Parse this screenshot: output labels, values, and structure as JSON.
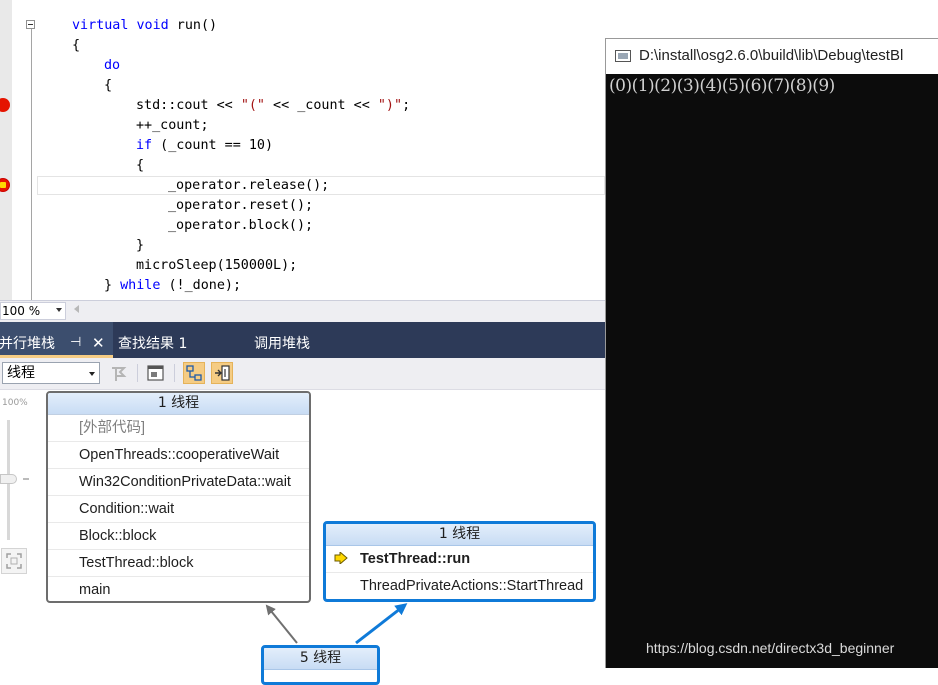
{
  "editor": {
    "lines": [
      {
        "indent": 0,
        "tokens": [
          {
            "t": "virtual void",
            "k": "kw"
          },
          {
            "t": " run()"
          }
        ]
      },
      {
        "indent": 0,
        "tokens": [
          {
            "t": "{"
          }
        ]
      },
      {
        "indent": 1,
        "tokens": [
          {
            "t": "do",
            "k": "kw"
          }
        ]
      },
      {
        "indent": 1,
        "tokens": [
          {
            "t": "{"
          }
        ]
      },
      {
        "indent": 2,
        "tokens": [
          {
            "t": "std::cout << "
          },
          {
            "t": "\"(\"",
            "k": "str"
          },
          {
            "t": " << _count << "
          },
          {
            "t": "\")\"",
            "k": "str"
          },
          {
            "t": ";"
          }
        ]
      },
      {
        "indent": 2,
        "tokens": [
          {
            "t": "++_count;"
          }
        ]
      },
      {
        "indent": 2,
        "tokens": [
          {
            "t": "if",
            "k": "kw"
          },
          {
            "t": " (_count == 10)"
          }
        ]
      },
      {
        "indent": 2,
        "tokens": [
          {
            "t": "{"
          }
        ]
      },
      {
        "indent": 3,
        "tokens": [
          {
            "t": "_operator.release();"
          }
        ]
      },
      {
        "indent": 3,
        "tokens": [
          {
            "t": "_operator.reset();"
          }
        ]
      },
      {
        "indent": 3,
        "tokens": [
          {
            "t": "_operator.block();"
          }
        ]
      },
      {
        "indent": 2,
        "tokens": [
          {
            "t": "}"
          }
        ]
      },
      {
        "indent": 2,
        "tokens": [
          {
            "t": "microSleep(150000L);"
          }
        ]
      },
      {
        "indent": 1,
        "tokens": [
          {
            "t": "} "
          },
          {
            "t": "while",
            "k": "kw"
          },
          {
            "t": " (!_done);"
          }
        ]
      }
    ],
    "zoom": "100 %"
  },
  "console": {
    "title": "D:\\install\\osg2.6.0\\build\\lib\\Debug\\testBl",
    "output": "(0)(1)(2)(3)(4)(5)(6)(7)(8)(9)"
  },
  "tabs": {
    "active": "并行堆栈",
    "pin": "⊣",
    "close": "✕",
    "find": "查找结果 1",
    "callstack": "调用堆栈"
  },
  "toolbar": {
    "view_combo": "线程"
  },
  "canvas": {
    "zoom_label": "100%",
    "stack_left": {
      "header": "1 线程",
      "frames": [
        "[外部代码]",
        "OpenThreads::cooperativeWait",
        "Win32ConditionPrivateData::wait",
        "Condition::wait",
        "Block::block",
        "TestThread::block",
        "main"
      ]
    },
    "stack_right": {
      "header": "1 线程",
      "frames": [
        "TestThread::run",
        "ThreadPrivateActions::StartThread"
      ]
    },
    "stack_bottom": {
      "header": "5 线程"
    }
  },
  "watermark": "https://blog.csdn.net/directx3d_beginner",
  "colors": {
    "keyword": "#0000ff",
    "string": "#a31515",
    "tab_strip": "#2d3a58",
    "active_stack_border": "#0f7ad8",
    "breakpoint": "#e51400",
    "console_bg": "#0c0c0c"
  }
}
